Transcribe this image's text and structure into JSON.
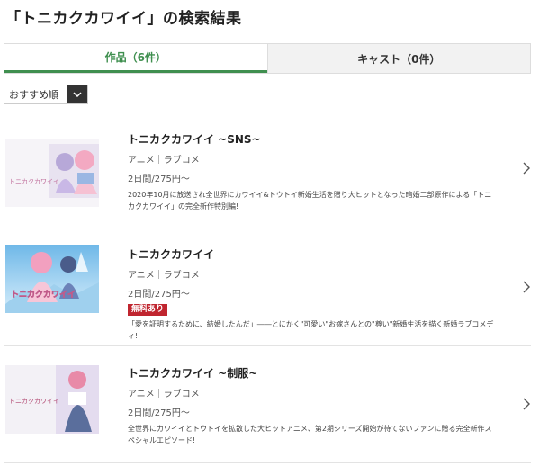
{
  "page_title": "「トニカクカワイイ」の検索結果",
  "tabs": [
    {
      "label": "作品（6件）",
      "active": true
    },
    {
      "label": "キャスト（0件）",
      "active": false
    }
  ],
  "sort": {
    "selected": "おすすめ順"
  },
  "items": [
    {
      "title": "トニカクカワイイ ~SNS~",
      "genre": "アニメ｜ラブコメ",
      "price": "2日間/275円～",
      "badge": "",
      "description": "2020年10月に放送され全世界にカワイイ&トウトイ新婚生活を贈り大ヒットとなった暗婚二部原作による「トニカクカワイイ」の完全新作特別編!"
    },
    {
      "title": "トニカクカワイイ",
      "genre": "アニメ｜ラブコメ",
      "price": "2日間/275円～",
      "badge": "無料あり",
      "description": "「愛を証明するために、結婚したんだ」――とにかく\"可愛い\"お嫁さんとの\"尊い\"新婚生活を描く新婚ラブコメディ!"
    },
    {
      "title": "トニカクカワイイ ~制服~",
      "genre": "アニメ｜ラブコメ",
      "price": "2日間/275円～",
      "badge": "",
      "description": "全世界にカワイイとトウトイを拡散した大ヒットアニメ、第2期シリーズ開始が待てないファンに贈る完全新作スペシャルエピソード!"
    }
  ],
  "thumb_logo_text": "トニカクカワイイ",
  "colors": {
    "accent": "#3f8f4f",
    "badge": "#c0252f"
  }
}
